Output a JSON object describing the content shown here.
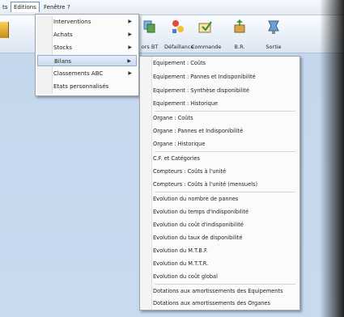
{
  "menubar": {
    "items": [
      "ts",
      "Editions",
      "Fenêtre",
      "?"
    ]
  },
  "toolbar": {
    "buttons": [
      {
        "label": "ors BT",
        "icon": "work-order-icon"
      },
      {
        "label": "Défaillance",
        "icon": "failure-icon"
      },
      {
        "label": "Commande",
        "icon": "order-icon"
      },
      {
        "label": "B.R.",
        "icon": "delivery-icon"
      },
      {
        "label": "Sortie",
        "icon": "exit-icon"
      }
    ]
  },
  "editions_menu": {
    "items": [
      {
        "label": "Interventions",
        "submenu": true
      },
      {
        "label": "Achats",
        "submenu": true
      },
      {
        "label": "Stocks",
        "submenu": true
      },
      {
        "label": "Bilans",
        "submenu": true
      },
      {
        "label": "Classements ABC",
        "submenu": true
      },
      {
        "label": "Etats personnalisés",
        "submenu": false
      }
    ],
    "highlighted": "Bilans"
  },
  "bilans_menu": {
    "items": [
      "Equipement : Coûts",
      "Equipement : Pannes et Indisponibilité",
      "Equipement : Synthèse disponibilité",
      "Equipement : Historique",
      "Organe : Coûts",
      "Organe : Pannes et Indisponibilité",
      "Organe : Historique",
      "C.F. et Catégories",
      "Compteurs : Coûts à l'unité",
      "Compteurs : Coûts à l'unité (mensuels)",
      "Evolution du nombre de pannes",
      "Evolution du temps d'indisponibilité",
      "Evolution du coût d'indisponibilité",
      "Evolution du taux de disponibilité",
      "Evolution du M.T.B.F.",
      "Evolution du M.T.T.R.",
      "Evolution du coût global",
      "Dotations aux amortissements des Equipements",
      "Dotations aux amortissements des Organes"
    ]
  }
}
